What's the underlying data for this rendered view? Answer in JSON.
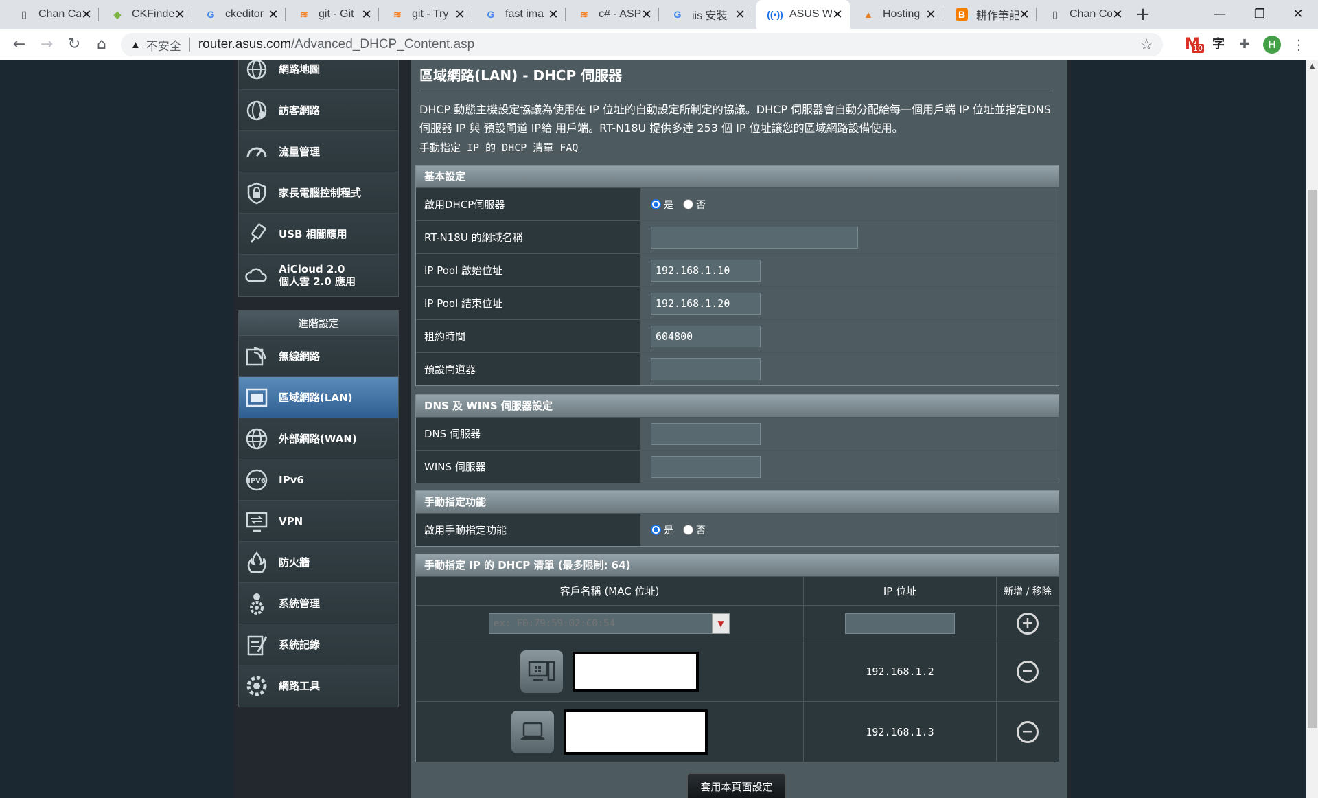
{
  "browser": {
    "tabs": [
      {
        "title": "Chan Ca",
        "icon": "doc-icon",
        "color": "#5f6368"
      },
      {
        "title": "CKFinde",
        "icon": "ckfinder-icon",
        "color": "#7cb342"
      },
      {
        "title": "ckeditor",
        "icon": "google-icon",
        "color": "#4285f4"
      },
      {
        "title": "git - Git",
        "icon": "stackoverflow-icon",
        "color": "#f48024"
      },
      {
        "title": "git - Try",
        "icon": "stackoverflow-icon",
        "color": "#f48024"
      },
      {
        "title": "fast ima",
        "icon": "google-icon",
        "color": "#4285f4"
      },
      {
        "title": "c# - ASP",
        "icon": "stackoverflow-icon",
        "color": "#f48024"
      },
      {
        "title": "iis 安裝",
        "icon": "google-icon",
        "color": "#4285f4"
      },
      {
        "title": "ASUS W",
        "icon": "wireless-icon",
        "color": "#1a73e8",
        "active": true
      },
      {
        "title": "Hosting",
        "icon": "hosting-icon",
        "color": "#e67e22"
      },
      {
        "title": "耕作筆記",
        "icon": "blogger-icon",
        "color": "#f57d00"
      },
      {
        "title": "Chan Co",
        "icon": "doc-icon",
        "color": "#5f6368"
      }
    ],
    "insecure_label": "不安全",
    "url_host": "router.asus.com",
    "url_path": "/Advanced_DHCP_Content.asp",
    "gmail_badge": "10",
    "translate_glyph": "字",
    "profile_initial": "H"
  },
  "sidebar": {
    "top_items": [
      {
        "label": "網路地圖",
        "icon": "globe-icon"
      },
      {
        "label": "訪客網路",
        "icon": "guest-network-icon"
      },
      {
        "label": "流量管理",
        "icon": "speedometer-icon"
      },
      {
        "label": "家長電腦控制程式",
        "icon": "parental-lock-icon"
      },
      {
        "label": "USB 相關應用",
        "icon": "usb-icon"
      },
      {
        "label": "AiCloud 2.0",
        "label2": "個人雲 2.0 應用",
        "icon": "cloud-icon"
      }
    ],
    "advanced_header": "進階設定",
    "advanced_items": [
      {
        "label": "無線網路",
        "icon": "wireless-icon"
      },
      {
        "label": "區域網路(LAN)",
        "icon": "lan-icon",
        "selected": true
      },
      {
        "label": "外部網路(WAN)",
        "icon": "wan-globe-icon"
      },
      {
        "label": "IPv6",
        "icon": "ipv6-icon"
      },
      {
        "label": "VPN",
        "icon": "vpn-icon"
      },
      {
        "label": "防火牆",
        "icon": "firewall-icon"
      },
      {
        "label": "系統管理",
        "icon": "admin-gear-icon"
      },
      {
        "label": "系統記錄",
        "icon": "log-icon"
      },
      {
        "label": "網路工具",
        "icon": "network-tools-icon"
      }
    ]
  },
  "content": {
    "title": "區域網路(LAN) - DHCP 伺服器",
    "description": "DHCP 動態主機設定協議為使用在 IP 位址的自動設定所制定的協議。DHCP 伺服器會自動分配給每一個用戶端 IP 位址並指定DNS 伺服器 IP 與 預設閘道 IP給 用戶端。RT-N18U 提供多達 253 個 IP 位址讓您的區域網路設備使用。",
    "faq_link": "手動指定 IP 的 DHCP 清單 FAQ",
    "basic": {
      "header": "基本設定",
      "enable_dhcp_label": "啟用DHCP伺服器",
      "yes": "是",
      "no": "否",
      "domain_label": "RT-N18U 的網域名稱",
      "domain_value": "",
      "pool_start_label": "IP Pool 啟始位址",
      "pool_start_value": "192.168.1.10",
      "pool_end_label": "IP Pool 結束位址",
      "pool_end_value": "192.168.1.20",
      "lease_label": "租約時間",
      "lease_value": "604800",
      "gateway_label": "預設閘道器",
      "gateway_value": ""
    },
    "dns": {
      "header": "DNS 及 WINS 伺服器設定",
      "dns_label": "DNS 伺服器",
      "dns_value": "",
      "wins_label": "WINS 伺服器",
      "wins_value": ""
    },
    "manual": {
      "header": "手動指定功能",
      "enable_label": "啟用手動指定功能",
      "yes": "是",
      "no": "否"
    },
    "list": {
      "header": "手動指定 IP 的 DHCP 清單 (最多限制: 64)",
      "col_client": "客戶名稱 (MAC 位址)",
      "col_ip": "IP 位址",
      "col_action": "新增 / 移除",
      "mac_placeholder": "ex: F0:79:59:02:C0:54",
      "entries": [
        {
          "ip": "192.168.1.2",
          "device_icon": "desktop-windows-icon"
        },
        {
          "ip": "192.168.1.3",
          "device_icon": "laptop-icon"
        }
      ]
    },
    "apply_label": "套用本頁面設定"
  }
}
